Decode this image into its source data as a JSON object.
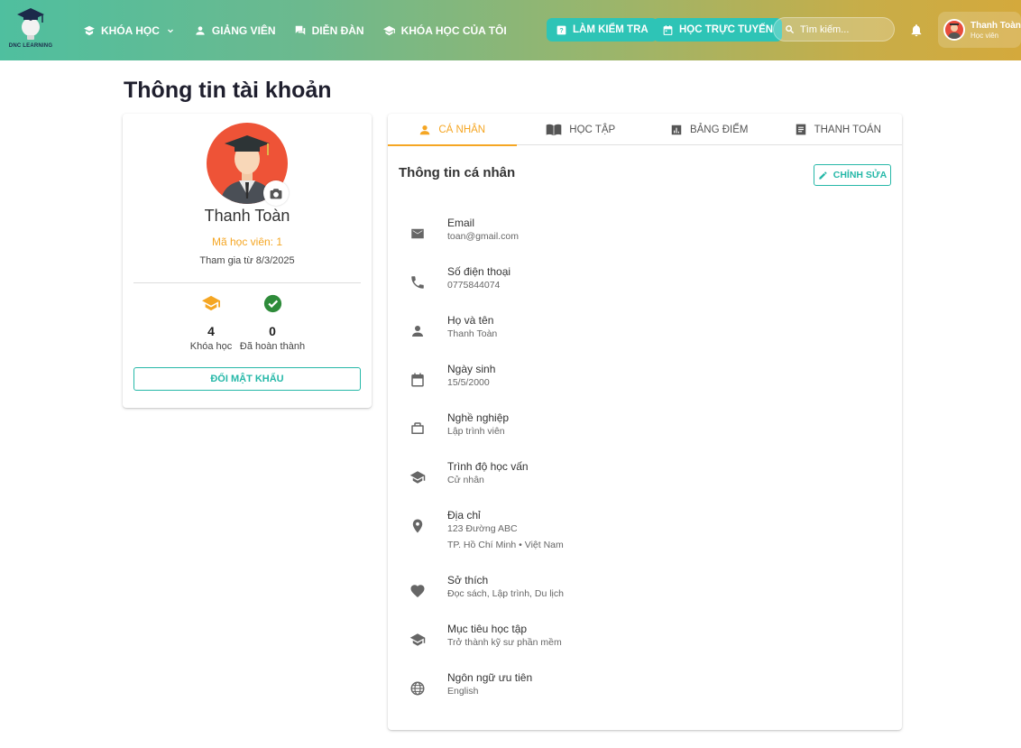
{
  "header": {
    "logo_text": "DNC LEARNING",
    "nav": [
      {
        "label": "KHÓA HỌC"
      },
      {
        "label": "GIẢNG VIÊN"
      },
      {
        "label": "DIỄN ĐÀN"
      },
      {
        "label": "KHÓA HỌC CỦA TÔI"
      }
    ],
    "btn_test": "LÀM KIỂM TRA",
    "btn_online": "HỌC TRỰC TUYẾN",
    "search_placeholder": "Tìm kiếm...",
    "user_name": "Thanh Toàn",
    "user_role": "Học viên"
  },
  "page": {
    "title": "Thông tin tài khoản"
  },
  "profile": {
    "name": "Thanh Toàn",
    "student_code": "Mã học viên: 1",
    "join_date": "Tham gia từ 8/3/2025",
    "stats": [
      {
        "value": "4",
        "label": "Khóa học"
      },
      {
        "value": "0",
        "label": "Đã hoàn thành"
      }
    ],
    "change_password": "ĐỔI MẬT KHẨU"
  },
  "tabs": [
    {
      "label": "Cá nhân",
      "active": true
    },
    {
      "label": "Học tập",
      "active": false
    },
    {
      "label": "Bảng điểm",
      "active": false
    },
    {
      "label": "Thanh toán",
      "active": false
    }
  ],
  "personal": {
    "title": "Thông tin cá nhân",
    "edit": "CHỈNH SỬA",
    "fields": [
      {
        "key": "Email",
        "value": "toan@gmail.com",
        "icon": "email-icon"
      },
      {
        "key": "Số điện thoại",
        "value": "0775844074",
        "icon": "phone-icon"
      },
      {
        "key": "Họ và tên",
        "value": "Thanh Toàn",
        "icon": "person-icon"
      },
      {
        "key": "Ngày sinh",
        "value": "15/5/2000",
        "icon": "calendar-icon"
      },
      {
        "key": "Nghề nghiệp",
        "value": "Lập trình viên",
        "icon": "briefcase-icon"
      },
      {
        "key": "Trình độ học vấn",
        "value": "Cử nhân",
        "icon": "graduation-cap-icon"
      },
      {
        "key": "Địa chỉ",
        "value": "123 Đường ABC",
        "value2": "TP. Hồ Chí Minh  •  Việt Nam",
        "icon": "location-icon"
      },
      {
        "key": "Sở thích",
        "value": "Đọc sách, Lập trình, Du lịch",
        "icon": "heart-icon"
      },
      {
        "key": "Mục tiêu học tập",
        "value": "Trở thành kỹ sư phần mềm",
        "icon": "school-icon"
      },
      {
        "key": "Ngôn ngữ ưu tiên",
        "value": "English",
        "icon": "globe-icon"
      }
    ]
  },
  "colors": {
    "accent": "#26b8a8",
    "orange": "#f5a623",
    "avatar_bg": "#ee5337"
  }
}
